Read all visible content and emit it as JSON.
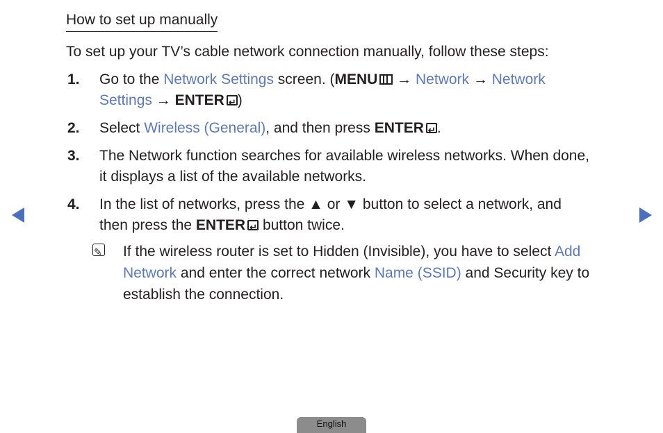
{
  "heading": "How to set up manually",
  "intro": "To set up your TV’s cable network connection manually, follow these steps:",
  "steps": [
    {
      "num": "1.",
      "t1": "Go to the ",
      "l1": "Network Settings",
      "t2": " screen. (",
      "menu": "MENU",
      "arrow": " → ",
      "l2": "Network",
      "arrow2": " → ",
      "l3": "Network",
      "l4": "Settings",
      "arrow3": " → ",
      "enter": "ENTER",
      "t3": ")"
    },
    {
      "num": "2.",
      "t1": "Select ",
      "l1": "Wireless (General)",
      "t2": ", and then press ",
      "enter": "ENTER",
      "t3": "."
    },
    {
      "num": "3.",
      "line1": "The Network function searches for available wireless networks. When done,",
      "line2": "it displays a list of the available networks."
    },
    {
      "num": "4.",
      "line1": "In the list of networks, press the ▲ or ▼ button to select a network, and",
      "t1": "then press the ",
      "enter": "ENTER",
      "t2": " button twice."
    }
  ],
  "note": {
    "t1": "If the wireless router is set to Hidden (Invisible), you have to select ",
    "l1": "Add Network",
    "t2": " and enter the correct network ",
    "l2": "Name (SSID)",
    "t3": " and Security key to establish the connection."
  },
  "nav": {
    "prev": "previous-page",
    "next": "next-page"
  },
  "language_tab": "English",
  "colors": {
    "link": "#5a7abd",
    "nav_arrow": "#4a6fbf",
    "tab": "#8c8c8c"
  }
}
